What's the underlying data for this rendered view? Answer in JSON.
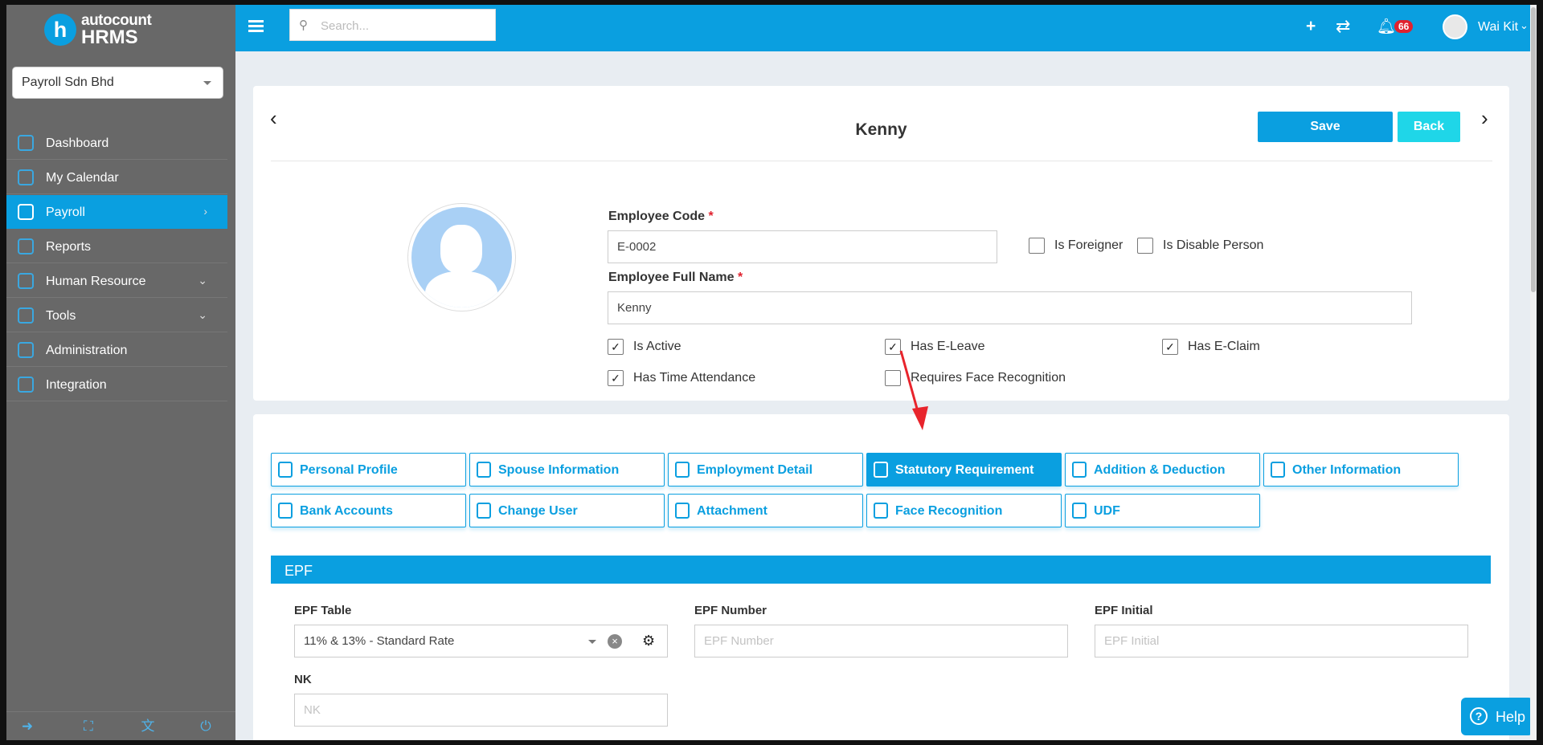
{
  "app": {
    "logo_top": "autocount",
    "logo_bottom": "HRMS",
    "logo_letter": "h",
    "accent_color": "#0a9fe0"
  },
  "sidebar": {
    "company": "Payroll Sdn Bhd",
    "items": [
      {
        "label": "Dashboard",
        "icon": "dashboard-icon",
        "active": false,
        "chevron": ""
      },
      {
        "label": "My Calendar",
        "icon": "calendar-icon",
        "active": false,
        "chevron": ""
      },
      {
        "label": "Payroll",
        "icon": "payroll-icon",
        "active": true,
        "chevron": "›"
      },
      {
        "label": "Reports",
        "icon": "reports-icon",
        "active": false,
        "chevron": ""
      },
      {
        "label": "Human Resource",
        "icon": "human-resource-icon",
        "active": false,
        "chevron": "⌄"
      },
      {
        "label": "Tools",
        "icon": "tools-icon",
        "active": false,
        "chevron": "⌄"
      },
      {
        "label": "Administration",
        "icon": "administration-icon",
        "active": false,
        "chevron": ""
      },
      {
        "label": "Integration",
        "icon": "integration-icon",
        "active": false,
        "chevron": ""
      }
    ],
    "bottom_icons": [
      "logout-icon",
      "fullscreen-icon",
      "language-icon",
      "power-icon"
    ]
  },
  "topbar": {
    "search_placeholder": "Search...",
    "notification_count": "66",
    "user_name": "Wai Kit"
  },
  "employee": {
    "name": "Kenny",
    "save_label": "Save",
    "back_label": "Back",
    "code_label": "Employee Code",
    "code_value": "E-0002",
    "fullname_label": "Employee Full Name",
    "fullname_value": "Kenny",
    "required_mark": "*",
    "is_foreigner_label": "Is Foreigner",
    "is_foreigner": false,
    "is_disable_label": "Is Disable Person",
    "is_disable": false,
    "flags": [
      {
        "label": "Is Active",
        "checked": true
      },
      {
        "label": "Has E-Leave",
        "checked": true
      },
      {
        "label": "Has E-Claim",
        "checked": true
      },
      {
        "label": "Has Time Attendance",
        "checked": true
      },
      {
        "label": "Requires Face Recognition",
        "checked": false
      }
    ]
  },
  "tabs": [
    {
      "label": "Personal Profile",
      "icon": "personal-profile-icon",
      "active": false
    },
    {
      "label": "Spouse Information",
      "icon": "spouse-icon",
      "active": false
    },
    {
      "label": "Employment Detail",
      "icon": "employment-icon",
      "active": false
    },
    {
      "label": "Statutory Requirement",
      "icon": "statutory-icon",
      "active": true
    },
    {
      "label": "Addition & Deduction",
      "icon": "addition-deduction-icon",
      "active": false
    },
    {
      "label": "Other Information",
      "icon": "cv-icon",
      "active": false
    },
    {
      "label": "Bank Accounts",
      "icon": "bank-icon",
      "active": false
    },
    {
      "label": "Change User",
      "icon": "user-add-icon",
      "active": false
    },
    {
      "label": "Attachment",
      "icon": "attachment-icon",
      "active": false
    },
    {
      "label": "Face Recognition",
      "icon": "face-icon",
      "active": false
    },
    {
      "label": "UDF",
      "icon": "udf-icon",
      "active": false
    }
  ],
  "epf": {
    "section_title": "EPF",
    "table_label": "EPF Table",
    "table_value": "11% & 13% - Standard Rate",
    "number_label": "EPF Number",
    "number_placeholder": "EPF Number",
    "initial_label": "EPF Initial",
    "initial_placeholder": "EPF Initial",
    "nk_label": "NK",
    "nk_placeholder": "NK"
  },
  "help": {
    "label": "Help",
    "symbol": "?"
  }
}
